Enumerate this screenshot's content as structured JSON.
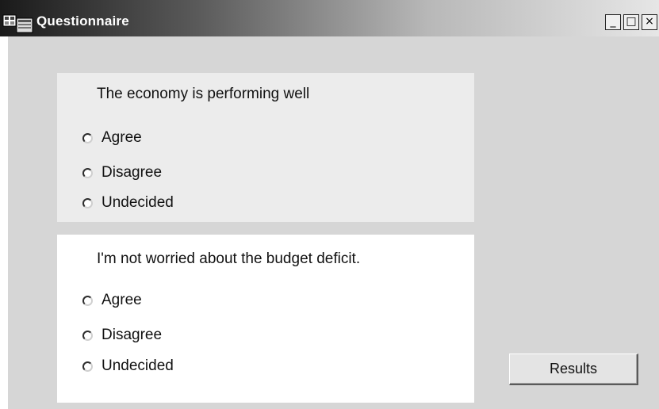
{
  "window": {
    "title": "Questionnaire",
    "controls": {
      "minimize": "_",
      "maximize": "□",
      "close": "×"
    }
  },
  "questions": [
    {
      "text": "The economy is performing well",
      "options": [
        "Agree",
        "Disagree",
        "Undecided"
      ]
    },
    {
      "text": "I'm not worried about the budget deficit.",
      "options": [
        "Agree",
        "Disagree",
        "Undecided"
      ]
    }
  ],
  "results_button": {
    "label": "Results"
  },
  "icons": {
    "app": "application-form-icon",
    "minimize": "minimize-icon",
    "maximize": "maximize-icon",
    "close": "close-icon",
    "radio": "radio-unchecked-icon"
  }
}
